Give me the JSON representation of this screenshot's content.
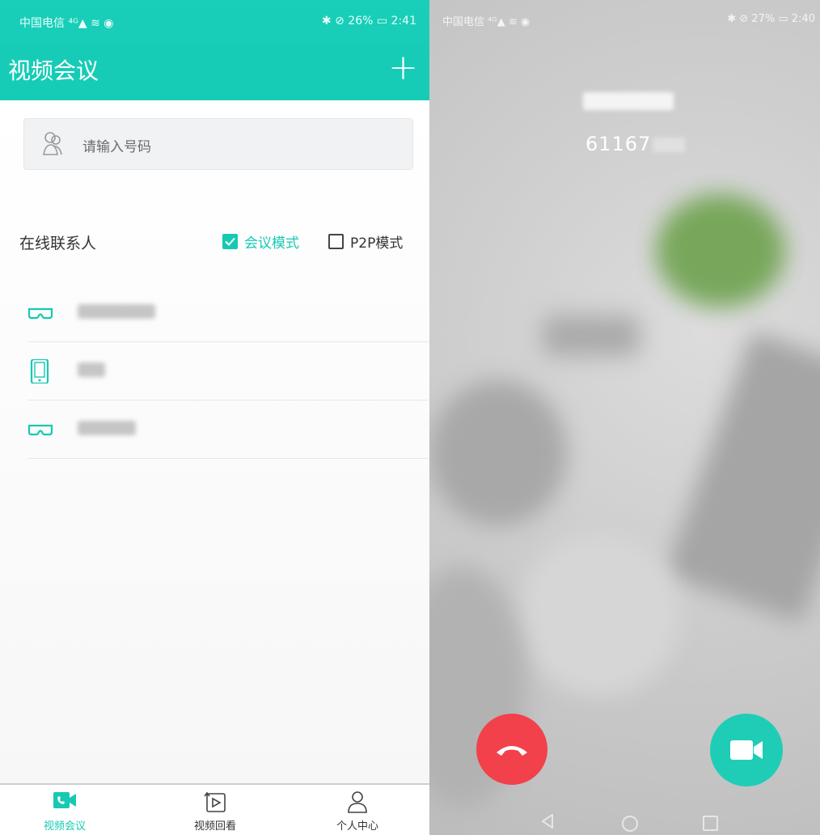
{
  "left": {
    "status": {
      "carrier": "中国电信",
      "battery": "26%",
      "time": "2:41"
    },
    "appbar": {
      "title": "视频会议",
      "add_symbol": "+"
    },
    "search": {
      "placeholder": "请输入号码"
    },
    "online": {
      "label": "在线联系人",
      "meeting_mode_label": "会议模式",
      "meeting_mode_checked": true,
      "p2p_mode_label": "P2P模式",
      "p2p_mode_checked": false
    },
    "contacts": [
      {
        "device_icon": "vr-glasses-icon"
      },
      {
        "device_icon": "phone-icon"
      },
      {
        "device_icon": "vr-glasses-icon"
      }
    ],
    "bottom_tabs": [
      {
        "label": "视频会议",
        "icon": "video-call-icon",
        "active": true
      },
      {
        "label": "视频回看",
        "icon": "playback-icon",
        "active": false
      },
      {
        "label": "个人中心",
        "icon": "person-icon",
        "active": false
      }
    ]
  },
  "right": {
    "status": {
      "carrier": "中国电信",
      "battery": "27%",
      "time": "2:40"
    },
    "caller": {
      "number_visible": "61167"
    },
    "colors": {
      "hangup": "#f2414a",
      "video": "#1fcdb7",
      "accent": "#17ccb6"
    }
  }
}
